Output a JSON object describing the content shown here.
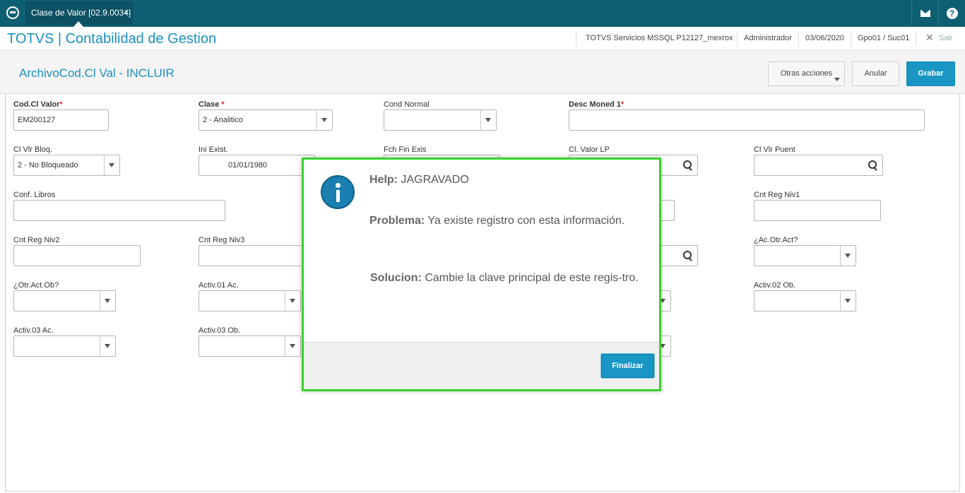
{
  "topbar": {
    "tab_label": "Clase de Valor [02.9.0034]",
    "tab_close": "×"
  },
  "appbar": {
    "title": "TOTVS | Contabilidad de Gestion",
    "server": "TOTVS Servicios MSSQL P12127_mexrox",
    "user": "Administrador",
    "date": "03/06/2020",
    "branch": "Gpo01 / Suc01",
    "exit_label": "Sair"
  },
  "form": {
    "title": "ArchivoCod.Cl Val - INCLUIR",
    "buttons": {
      "otras": "Otras acciones",
      "anular": "Anular",
      "grabar": "Grabar"
    },
    "fields": {
      "cod_cl_valor": {
        "label": "Cod.Cl Valor",
        "value": "EM200127"
      },
      "clase": {
        "label": "Clase",
        "value": "2 - Analitico"
      },
      "cond_normal": {
        "label": "Cond Normal",
        "value": ""
      },
      "desc_moned1": {
        "label": "Desc Moned 1",
        "value": ""
      },
      "cl_vlr_bloq": {
        "label": "Cl Vlr Bloq.",
        "value": "2 - No Bloqueado"
      },
      "ini_exist": {
        "label": "Ini Exist.",
        "value": "01/01/1980"
      },
      "fch_fin_exis": {
        "label": "Fch Fin Exis",
        "value": ""
      },
      "cl_valor_lp": {
        "label": "Cl. Valor LP",
        "value": ""
      },
      "cl_vlr_puent": {
        "label": "Cl Vlr Puent",
        "value": ""
      },
      "conf_libros": {
        "label": "Conf. Libros",
        "value": ""
      },
      "cnt_reg_niv1": {
        "label": "Cnt Reg Niv1",
        "value": ""
      },
      "cnt_reg_niv2": {
        "label": "Cnt Reg Niv2",
        "value": ""
      },
      "cnt_reg_niv3": {
        "label": "Cnt Reg Niv3",
        "value": ""
      },
      "ac_otr_act": {
        "label": "¿Ac.Otr.Act?",
        "value": ""
      },
      "otr_act_ob": {
        "label": "¿Otr.Act.Ob?",
        "value": ""
      },
      "activ01_ac": {
        "label": "Activ.01 Ac.",
        "value": ""
      },
      "activ02_ob": {
        "label": "Activ.02 Ob.",
        "value": ""
      },
      "activ03_ac": {
        "label": "Activ.03 Ac.",
        "value": ""
      },
      "activ03_ob": {
        "label": "Activ.03 Ob.",
        "value": ""
      }
    },
    "required_mark": "*"
  },
  "modal": {
    "help_label": "Help:",
    "help_value": "JAGRAVADO",
    "problema_label": "Problema:",
    "problema_value": "Ya existe registro con esta información.",
    "solucion_label": "Solucion:",
    "solucion_value": "Cambie la clave principal de este regis-tro.",
    "finalizar": "Finalizar"
  },
  "colors": {
    "topbar": "#0f5f73",
    "accent": "#1a8fbf",
    "primary_button": "#1a96c4",
    "modal_border": "#39d12b",
    "required": "#d9232d"
  },
  "icons": [
    "logo-icon",
    "mail-icon",
    "help-icon",
    "search-icon",
    "info-icon",
    "chevron-down-icon",
    "close-icon"
  ]
}
